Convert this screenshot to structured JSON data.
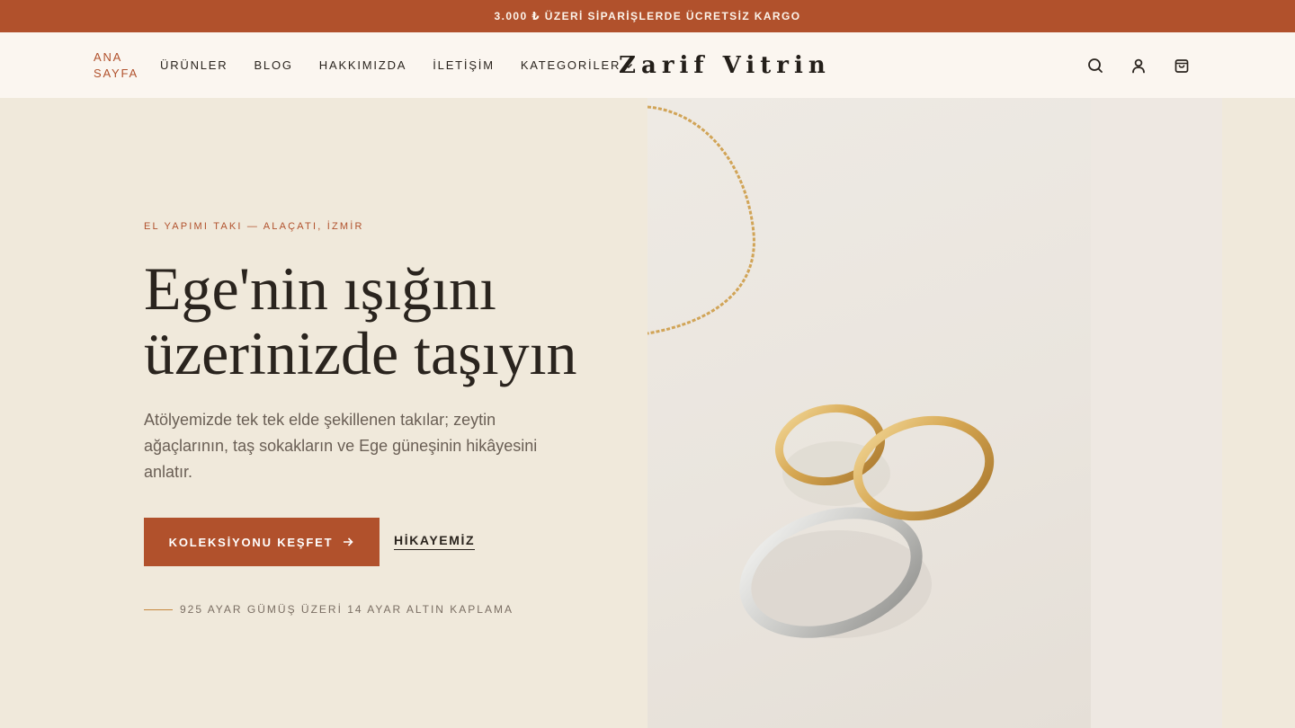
{
  "announcement": "3.000 ₺ ÜZERİ SİPARİŞLERDE ÜCRETSİZ KARGO",
  "header": {
    "nav": [
      {
        "label": "ANA SAYFA"
      },
      {
        "label": "ÜRÜNLER"
      },
      {
        "label": "BLOG"
      },
      {
        "label": "HAKKIMIZDA"
      },
      {
        "label": "İLETİŞİM"
      },
      {
        "label": "KATEGORİLER"
      }
    ],
    "logo": "Zarif Vitrin",
    "icons": [
      "search-icon",
      "user-icon",
      "shopping-bag-icon"
    ]
  },
  "hero": {
    "eyebrow": "EL YAPIMI TAKI — ALAÇATI, İZMİR",
    "headline_line1": "Ege'nin ışığını",
    "headline_line2": "üzerinizde taşıyın",
    "lead": "Atölyemizde tek tek elde şekillenen takılar; zeytin ağaçlarının, taş sokakların ve Ege güneşinin hikâyesini anlatır.",
    "primary_cta": "KOLEKSİYONU KEŞFET",
    "secondary_cta": "HİKAYEMİZ",
    "material_note": "925 AYAR GÜMÜŞ ÜZERİ 14 AYAR ALTIN KAPLAMA"
  },
  "colors": {
    "accent": "#B1512C",
    "background": "#F0E9DB",
    "header_bg": "#FBF6F0",
    "text": "#2A241E",
    "gold": "#C7873D"
  }
}
